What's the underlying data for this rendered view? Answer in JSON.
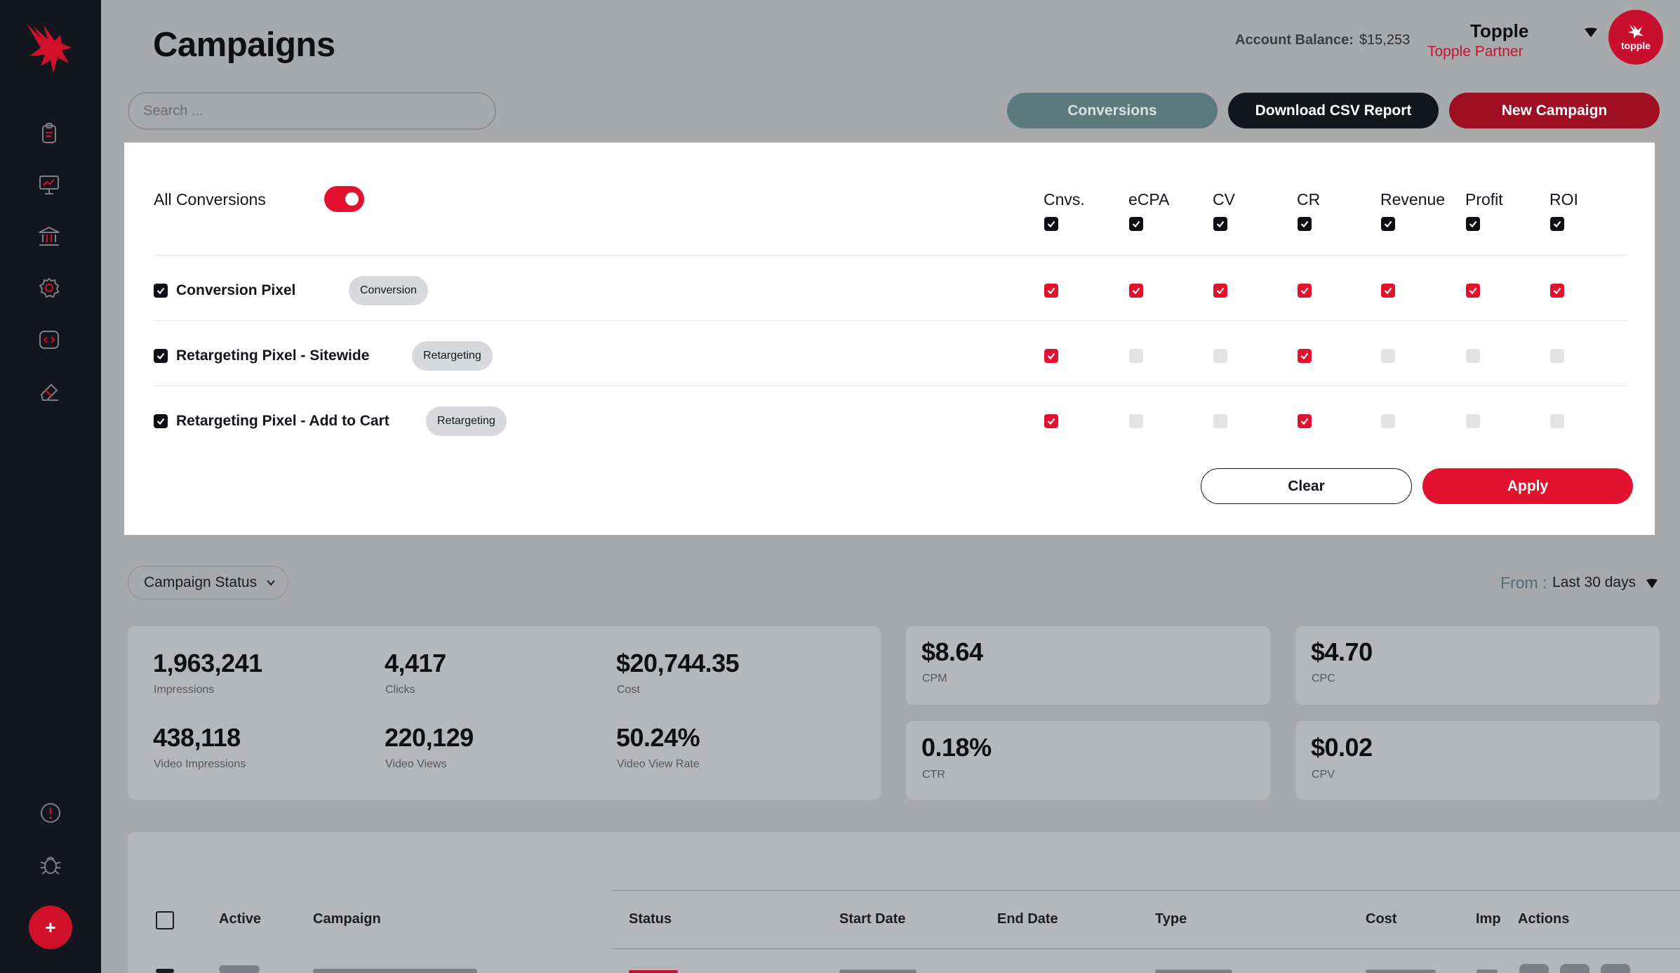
{
  "header": {
    "title": "Campaigns",
    "balance_label": "Account Balance:",
    "balance_value": "$15,253",
    "user_name": "Topple",
    "user_role": "Topple Partner",
    "avatar_text": "topple"
  },
  "toolbar": {
    "search_placeholder": "Search ...",
    "conversions_label": "Conversions",
    "csv_label": "Download CSV Report",
    "new_campaign_label": "New Campaign"
  },
  "conversions_panel": {
    "all_label": "All Conversions",
    "all_enabled": true,
    "columns": [
      "Cnvs.",
      "eCPA",
      "CV",
      "CR",
      "Revenue",
      "Profit",
      "ROI"
    ],
    "rows": [
      {
        "name": "Conversion Pixel",
        "tag": "Conversion",
        "checked": [
          true,
          true,
          true,
          true,
          true,
          true,
          true
        ]
      },
      {
        "name": "Retargeting Pixel - Sitewide",
        "tag": "Retargeting",
        "checked": [
          true,
          false,
          false,
          true,
          false,
          false,
          false
        ]
      },
      {
        "name": "Retargeting Pixel - Add to Cart",
        "tag": "Retargeting",
        "checked": [
          true,
          false,
          false,
          true,
          false,
          false,
          false
        ]
      }
    ],
    "clear_label": "Clear",
    "apply_label": "Apply"
  },
  "filters": {
    "status_label": "Campaign Status",
    "from_label": "From :",
    "from_value": "Last 30 days"
  },
  "stats": {
    "impressions": {
      "value": "1,963,241",
      "label": "Impressions"
    },
    "clicks": {
      "value": "4,417",
      "label": "Clicks"
    },
    "cost": {
      "value": "$20,744.35",
      "label": "Cost"
    },
    "video_impressions": {
      "value": "438,118",
      "label": "Video Impressions"
    },
    "video_views": {
      "value": "220,129",
      "label": "Video Views"
    },
    "video_view_rate": {
      "value": "50.24%",
      "label": "Video View Rate"
    },
    "cpm": {
      "value": "$8.64",
      "label": "CPM"
    },
    "cpc": {
      "value": "$4.70",
      "label": "CPC"
    },
    "ctr": {
      "value": "0.18%",
      "label": "CTR"
    },
    "cpv": {
      "value": "$0.02",
      "label": "CPV"
    }
  },
  "table": {
    "headers": [
      "Active",
      "Campaign",
      "Status",
      "Start Date",
      "End Date",
      "Type",
      "Cost",
      "Imp",
      "Actions"
    ]
  },
  "colors": {
    "brand_red": "#e2112f",
    "dark": "#14161d",
    "teal": "#5c7a7e"
  },
  "icons": [
    "logo-eagle",
    "clipboard-icon",
    "presentation-icon",
    "bank-icon",
    "gear-icon",
    "code-icon",
    "eraser-icon",
    "alert-icon",
    "bug-icon",
    "plus-icon"
  ]
}
